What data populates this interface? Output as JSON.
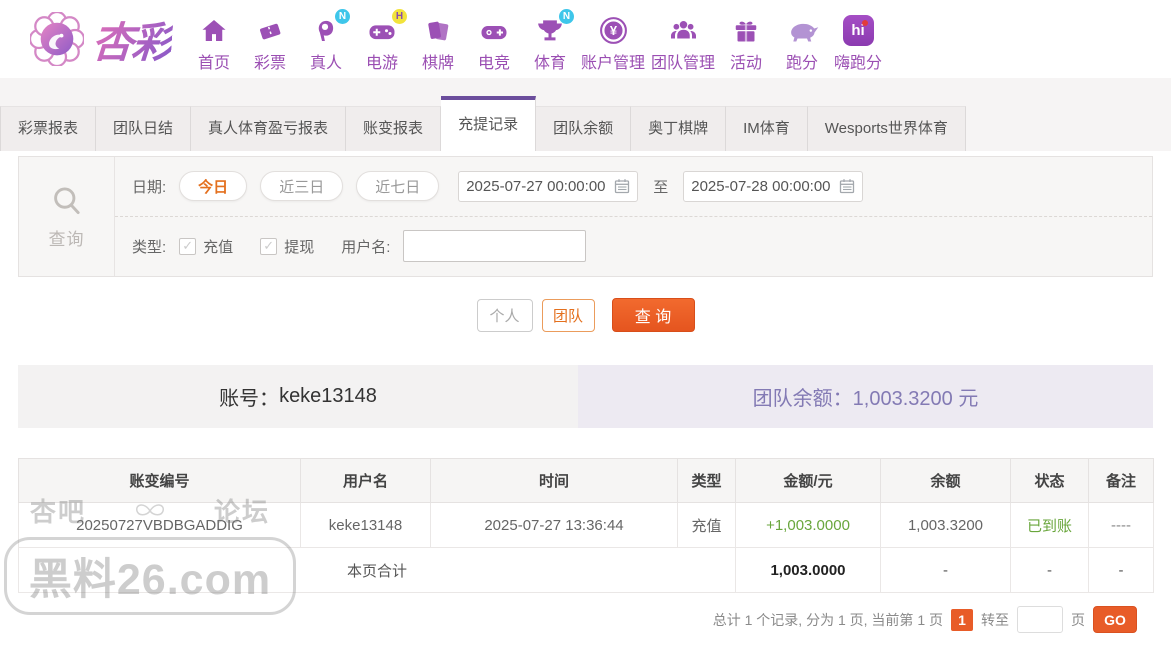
{
  "brand": {
    "name": "杏彩"
  },
  "nav": {
    "items": [
      {
        "label": "首页"
      },
      {
        "label": "彩票"
      },
      {
        "label": "真人",
        "badge": "N"
      },
      {
        "label": "电游",
        "badge": "H"
      },
      {
        "label": "棋牌"
      },
      {
        "label": "电竞"
      },
      {
        "label": "体育",
        "badge": "N"
      },
      {
        "label": "账户管理"
      },
      {
        "label": "团队管理"
      },
      {
        "label": "活动"
      },
      {
        "label": "跑分"
      },
      {
        "label": "嗨跑分",
        "icon_text": "hi"
      }
    ]
  },
  "tabs": {
    "items": [
      {
        "label": "彩票报表"
      },
      {
        "label": "团队日结"
      },
      {
        "label": "真人体育盈亏报表"
      },
      {
        "label": "账变报表"
      },
      {
        "label": "充提记录",
        "active": true
      },
      {
        "label": "团队余额"
      },
      {
        "label": "奥丁棋牌"
      },
      {
        "label": "IM体育"
      },
      {
        "label": "Wesports世界体育"
      }
    ]
  },
  "filter": {
    "side_label": "查询",
    "date_label": "日期:",
    "quick_ranges": [
      {
        "label": "今日"
      },
      {
        "label": "近三日"
      },
      {
        "label": "近七日"
      }
    ],
    "date_from": "2025-07-27 00:00:00",
    "range_separator": "至",
    "date_to": "2025-07-28 00:00:00",
    "type_label": "类型:",
    "type_options": [
      {
        "label": "充值",
        "checked": "✓"
      },
      {
        "label": "提现",
        "checked": "✓"
      }
    ],
    "username_label": "用户名:",
    "username_value": ""
  },
  "actions": {
    "personal": "个人",
    "team": "团队",
    "search": "查 询"
  },
  "account": {
    "label": "账号：",
    "value": "keke13148",
    "balance_label": "团队余额：",
    "balance_value": "1,003.3200 元"
  },
  "table": {
    "headers": [
      "账变编号",
      "用户名",
      "时间",
      "类型",
      "金额/元",
      "余额",
      "状态",
      "备注"
    ],
    "rows": [
      {
        "id": "20250727VBDBGADDIG",
        "username": "keke13148",
        "time": "2025-07-27 13:36:44",
        "type": "充值",
        "amount": "+1,003.0000",
        "balance": "1,003.3200",
        "status": "已到账",
        "note": "----"
      }
    ],
    "summary": {
      "label": "本页合计",
      "amount": "1,003.0000",
      "balance": "-",
      "status": "-",
      "note": "-"
    }
  },
  "pagination": {
    "summary": "总计 1 个记录, 分为 1 页, 当前第 1 页",
    "current_page": "1",
    "goto_label": "转至",
    "goto_value": "",
    "page_unit": "页",
    "go_label": "GO"
  },
  "watermark": {
    "top_left": "杏吧",
    "top_right": "论坛",
    "main": "黑料26.com"
  },
  "colors": {
    "accent_purple": "#6b4d9c",
    "nav_purple": "#9b4fb3",
    "accent_orange": "#e85c28",
    "positive_green": "#69a63c",
    "balance_purple": "#837ab4",
    "badge_cyan": "#3ec6ea",
    "badge_yellow": "#f2e33c"
  }
}
